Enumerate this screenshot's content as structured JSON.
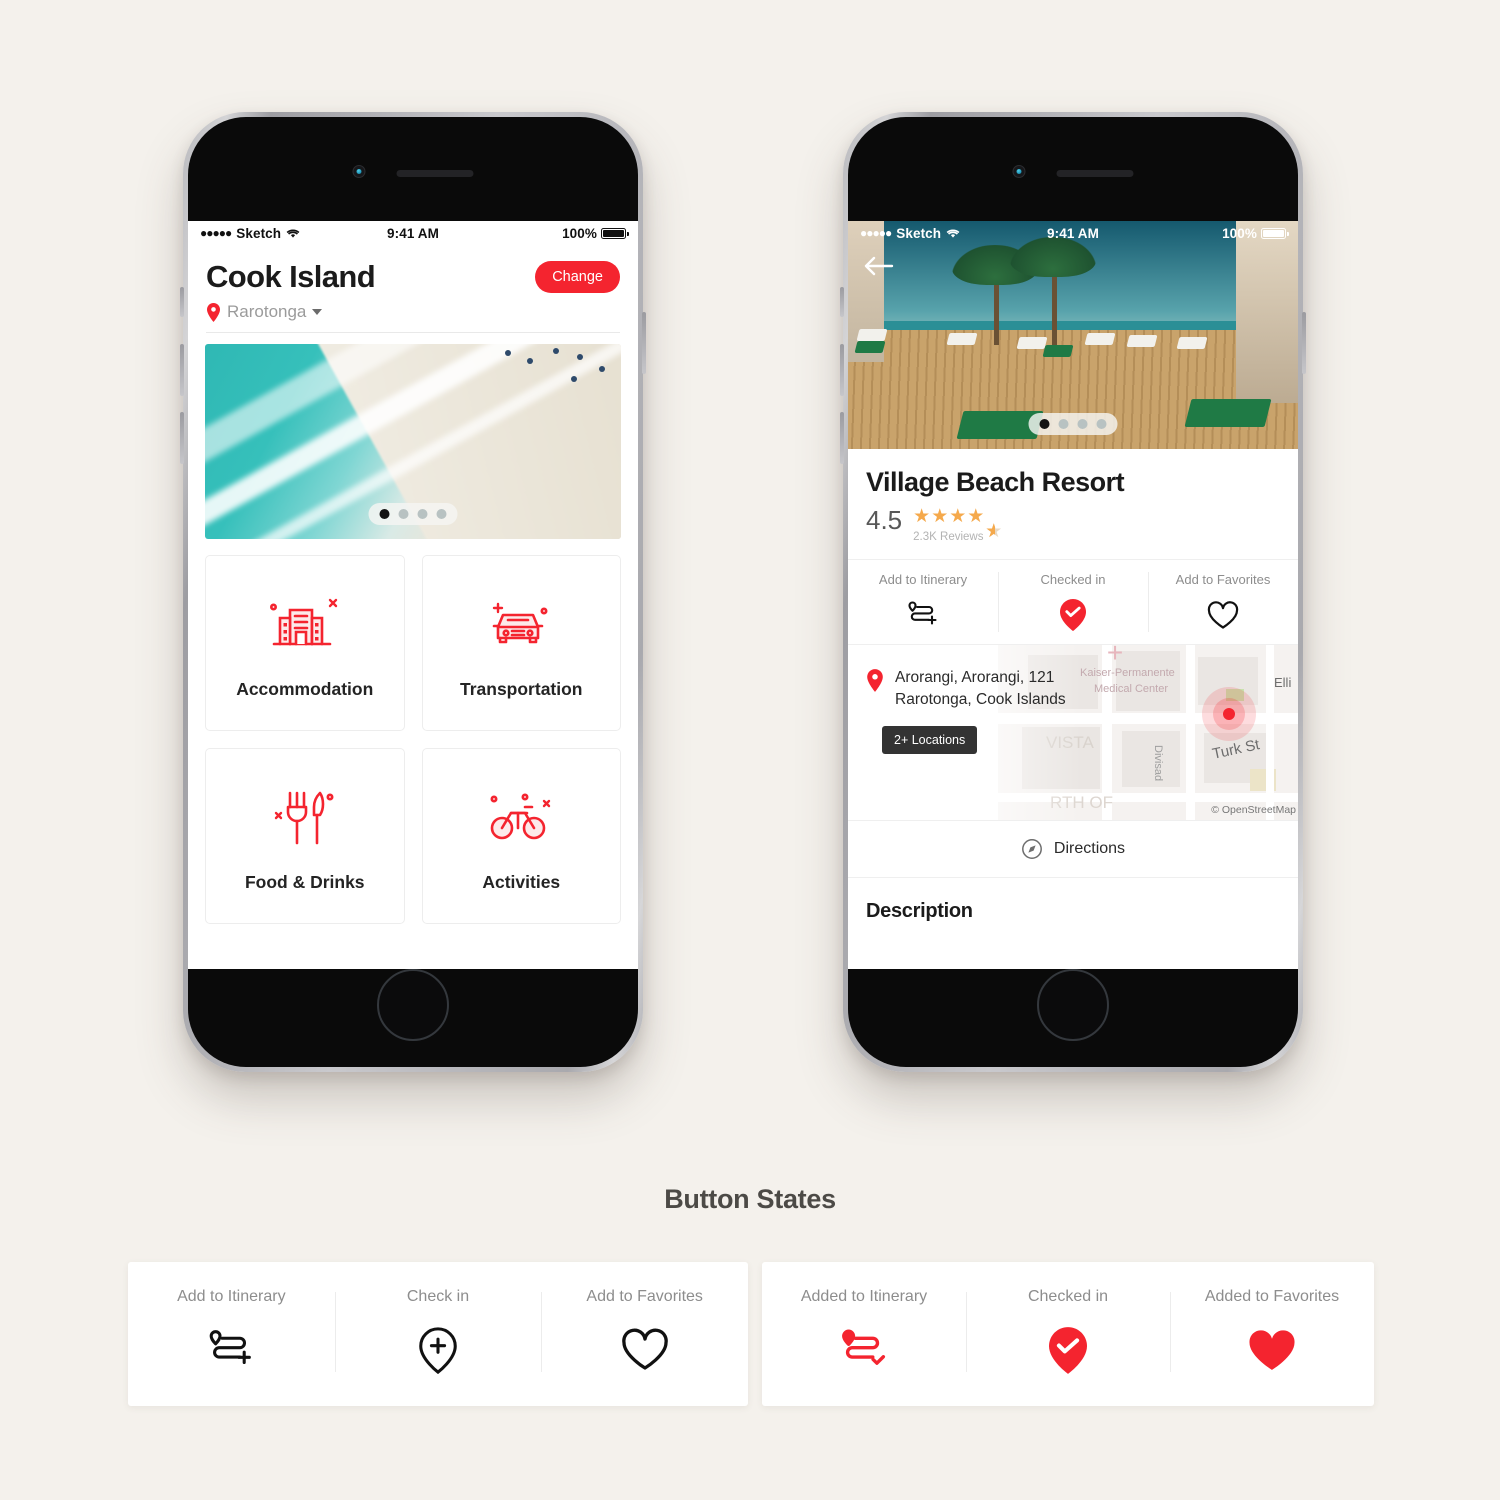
{
  "theme": {
    "accent": "#f4242f",
    "bg": "#f4f1ec",
    "text": "#1b1b1b",
    "muted": "#8d8d8d",
    "star": "#f5a94c"
  },
  "phone1": {
    "status": {
      "carrier": "Sketch",
      "dots": "●●●●●",
      "time": "9:41 AM",
      "battery": "100%"
    },
    "title": "Cook Island",
    "change_label": "Change",
    "location": "Rarotonga",
    "carousel": {
      "total": 4,
      "active": 1
    },
    "tiles": [
      {
        "label": "Accommodation",
        "icon": "building-icon"
      },
      {
        "label": "Transportation",
        "icon": "car-icon"
      },
      {
        "label": "Food & Drinks",
        "icon": "cutlery-icon"
      },
      {
        "label": "Activities",
        "icon": "bicycle-icon"
      }
    ]
  },
  "phone2": {
    "status": {
      "carrier": "Sketch",
      "dots": "●●●●●",
      "time": "9:41 AM",
      "battery": "100%"
    },
    "back_icon": "back-arrow-icon",
    "carousel": {
      "total": 4,
      "active": 1
    },
    "name": "Village Beach Resort",
    "rating": "4.5",
    "stars": "★★★★",
    "half_star": "⯪",
    "reviews": "2.3K Reviews",
    "actions": [
      {
        "label": "Add to Itinerary",
        "icon": "itinerary-add-icon",
        "state": "inactive"
      },
      {
        "label": "Checked in",
        "icon": "pin-check-icon",
        "state": "active"
      },
      {
        "label": "Add to Favorites",
        "icon": "heart-outline-icon",
        "state": "inactive"
      }
    ],
    "address_line1": "Arorangi, Arorangi, 121",
    "address_line2": "Rarotonga, Cook Islands",
    "locations_chip": "2+ Locations",
    "map": {
      "labels": [
        "Kaiser-Permanente",
        "Medical Center",
        "VISTA",
        "Divisad",
        "Turk St",
        "Elli",
        "RTH OF"
      ],
      "attribution": "© OpenStreetMap"
    },
    "directions_label": "Directions",
    "description_heading": "Description"
  },
  "states": {
    "title": "Button States",
    "inactive": [
      {
        "label": "Add to Itinerary",
        "icon": "itinerary-add-icon"
      },
      {
        "label": "Check in",
        "icon": "pin-plus-icon"
      },
      {
        "label": "Add to Favorites",
        "icon": "heart-outline-icon"
      }
    ],
    "active": [
      {
        "label": "Added to Itinerary",
        "icon": "itinerary-check-icon"
      },
      {
        "label": "Checked in",
        "icon": "pin-check-icon"
      },
      {
        "label": "Added to Favorites",
        "icon": "heart-filled-icon"
      }
    ]
  }
}
